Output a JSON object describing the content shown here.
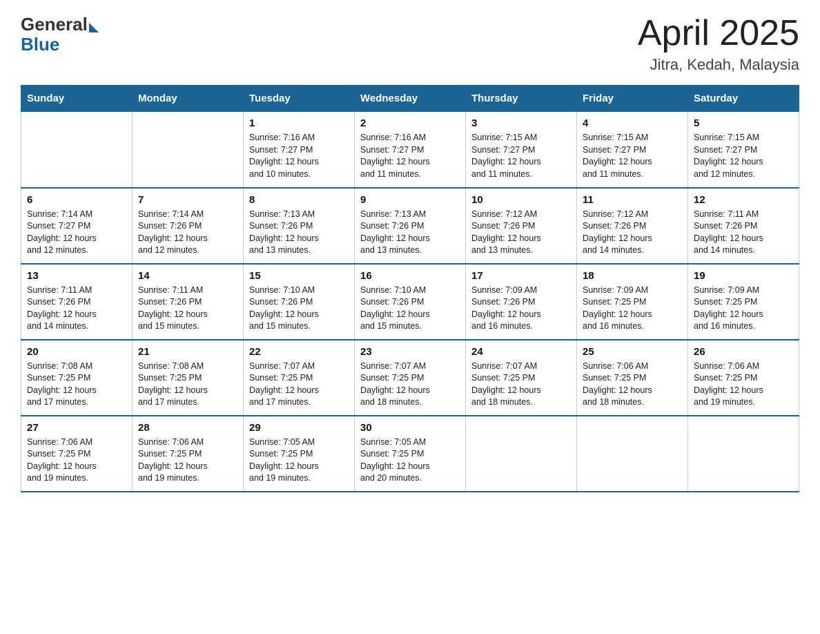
{
  "logo": {
    "general": "General",
    "blue": "Blue"
  },
  "title": "April 2025",
  "location": "Jitra, Kedah, Malaysia",
  "days_of_week": [
    "Sunday",
    "Monday",
    "Tuesday",
    "Wednesday",
    "Thursday",
    "Friday",
    "Saturday"
  ],
  "weeks": [
    [
      {
        "day": "",
        "info": ""
      },
      {
        "day": "",
        "info": ""
      },
      {
        "day": "1",
        "info": "Sunrise: 7:16 AM\nSunset: 7:27 PM\nDaylight: 12 hours\nand 10 minutes."
      },
      {
        "day": "2",
        "info": "Sunrise: 7:16 AM\nSunset: 7:27 PM\nDaylight: 12 hours\nand 11 minutes."
      },
      {
        "day": "3",
        "info": "Sunrise: 7:15 AM\nSunset: 7:27 PM\nDaylight: 12 hours\nand 11 minutes."
      },
      {
        "day": "4",
        "info": "Sunrise: 7:15 AM\nSunset: 7:27 PM\nDaylight: 12 hours\nand 11 minutes."
      },
      {
        "day": "5",
        "info": "Sunrise: 7:15 AM\nSunset: 7:27 PM\nDaylight: 12 hours\nand 12 minutes."
      }
    ],
    [
      {
        "day": "6",
        "info": "Sunrise: 7:14 AM\nSunset: 7:27 PM\nDaylight: 12 hours\nand 12 minutes."
      },
      {
        "day": "7",
        "info": "Sunrise: 7:14 AM\nSunset: 7:26 PM\nDaylight: 12 hours\nand 12 minutes."
      },
      {
        "day": "8",
        "info": "Sunrise: 7:13 AM\nSunset: 7:26 PM\nDaylight: 12 hours\nand 13 minutes."
      },
      {
        "day": "9",
        "info": "Sunrise: 7:13 AM\nSunset: 7:26 PM\nDaylight: 12 hours\nand 13 minutes."
      },
      {
        "day": "10",
        "info": "Sunrise: 7:12 AM\nSunset: 7:26 PM\nDaylight: 12 hours\nand 13 minutes."
      },
      {
        "day": "11",
        "info": "Sunrise: 7:12 AM\nSunset: 7:26 PM\nDaylight: 12 hours\nand 14 minutes."
      },
      {
        "day": "12",
        "info": "Sunrise: 7:11 AM\nSunset: 7:26 PM\nDaylight: 12 hours\nand 14 minutes."
      }
    ],
    [
      {
        "day": "13",
        "info": "Sunrise: 7:11 AM\nSunset: 7:26 PM\nDaylight: 12 hours\nand 14 minutes."
      },
      {
        "day": "14",
        "info": "Sunrise: 7:11 AM\nSunset: 7:26 PM\nDaylight: 12 hours\nand 15 minutes."
      },
      {
        "day": "15",
        "info": "Sunrise: 7:10 AM\nSunset: 7:26 PM\nDaylight: 12 hours\nand 15 minutes."
      },
      {
        "day": "16",
        "info": "Sunrise: 7:10 AM\nSunset: 7:26 PM\nDaylight: 12 hours\nand 15 minutes."
      },
      {
        "day": "17",
        "info": "Sunrise: 7:09 AM\nSunset: 7:26 PM\nDaylight: 12 hours\nand 16 minutes."
      },
      {
        "day": "18",
        "info": "Sunrise: 7:09 AM\nSunset: 7:25 PM\nDaylight: 12 hours\nand 16 minutes."
      },
      {
        "day": "19",
        "info": "Sunrise: 7:09 AM\nSunset: 7:25 PM\nDaylight: 12 hours\nand 16 minutes."
      }
    ],
    [
      {
        "day": "20",
        "info": "Sunrise: 7:08 AM\nSunset: 7:25 PM\nDaylight: 12 hours\nand 17 minutes."
      },
      {
        "day": "21",
        "info": "Sunrise: 7:08 AM\nSunset: 7:25 PM\nDaylight: 12 hours\nand 17 minutes."
      },
      {
        "day": "22",
        "info": "Sunrise: 7:07 AM\nSunset: 7:25 PM\nDaylight: 12 hours\nand 17 minutes."
      },
      {
        "day": "23",
        "info": "Sunrise: 7:07 AM\nSunset: 7:25 PM\nDaylight: 12 hours\nand 18 minutes."
      },
      {
        "day": "24",
        "info": "Sunrise: 7:07 AM\nSunset: 7:25 PM\nDaylight: 12 hours\nand 18 minutes."
      },
      {
        "day": "25",
        "info": "Sunrise: 7:06 AM\nSunset: 7:25 PM\nDaylight: 12 hours\nand 18 minutes."
      },
      {
        "day": "26",
        "info": "Sunrise: 7:06 AM\nSunset: 7:25 PM\nDaylight: 12 hours\nand 19 minutes."
      }
    ],
    [
      {
        "day": "27",
        "info": "Sunrise: 7:06 AM\nSunset: 7:25 PM\nDaylight: 12 hours\nand 19 minutes."
      },
      {
        "day": "28",
        "info": "Sunrise: 7:06 AM\nSunset: 7:25 PM\nDaylight: 12 hours\nand 19 minutes."
      },
      {
        "day": "29",
        "info": "Sunrise: 7:05 AM\nSunset: 7:25 PM\nDaylight: 12 hours\nand 19 minutes."
      },
      {
        "day": "30",
        "info": "Sunrise: 7:05 AM\nSunset: 7:25 PM\nDaylight: 12 hours\nand 20 minutes."
      },
      {
        "day": "",
        "info": ""
      },
      {
        "day": "",
        "info": ""
      },
      {
        "day": "",
        "info": ""
      }
    ]
  ]
}
